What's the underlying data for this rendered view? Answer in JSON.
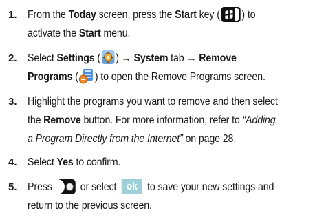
{
  "steps": [
    {
      "number": "1.",
      "p1": "From the ",
      "today": "Today",
      "p2": " screen, press the ",
      "start": "Start",
      "p3": " key (",
      "p4": ") to",
      "p5": "activate the ",
      "start2": "Start",
      "p6": " menu."
    },
    {
      "number": "2.",
      "p1": "Select ",
      "settings": "Settings",
      "p2": " (",
      "p3": ") → ",
      "system": "System",
      "p4": " tab → ",
      "remove": "Remove",
      "programs": "Programs",
      "p5": " (",
      "p6": ") to open the Remove Programs screen."
    },
    {
      "number": "3.",
      "p1": "Highlight the programs you want to remove and then select",
      "p2": "the ",
      "remove": "Remove",
      "p3": " button. For more information, refer to ",
      "link1": "“Adding",
      "link2": "a Program Directly from the Internet”",
      "p4": "  on page 28."
    },
    {
      "number": "4.",
      "p1": "Select ",
      "yes": "Yes",
      "p2": " to confirm."
    },
    {
      "number": "5.",
      "p1": "Press ",
      "p2": " or select ",
      "ok": "ok",
      "p3": " to save your new settings and",
      "p4": "return to the previous screen."
    }
  ],
  "icons": {
    "start_key": "windows-start-key-icon",
    "settings": "settings-gear-icon",
    "remove_programs": "remove-programs-icon",
    "ok_key": "ok-hardware-key-icon",
    "ok_soft": "ok-softkey-icon"
  },
  "colors": {
    "text": "#1a1a1a",
    "ok_softkey": "#9fd0d8"
  }
}
